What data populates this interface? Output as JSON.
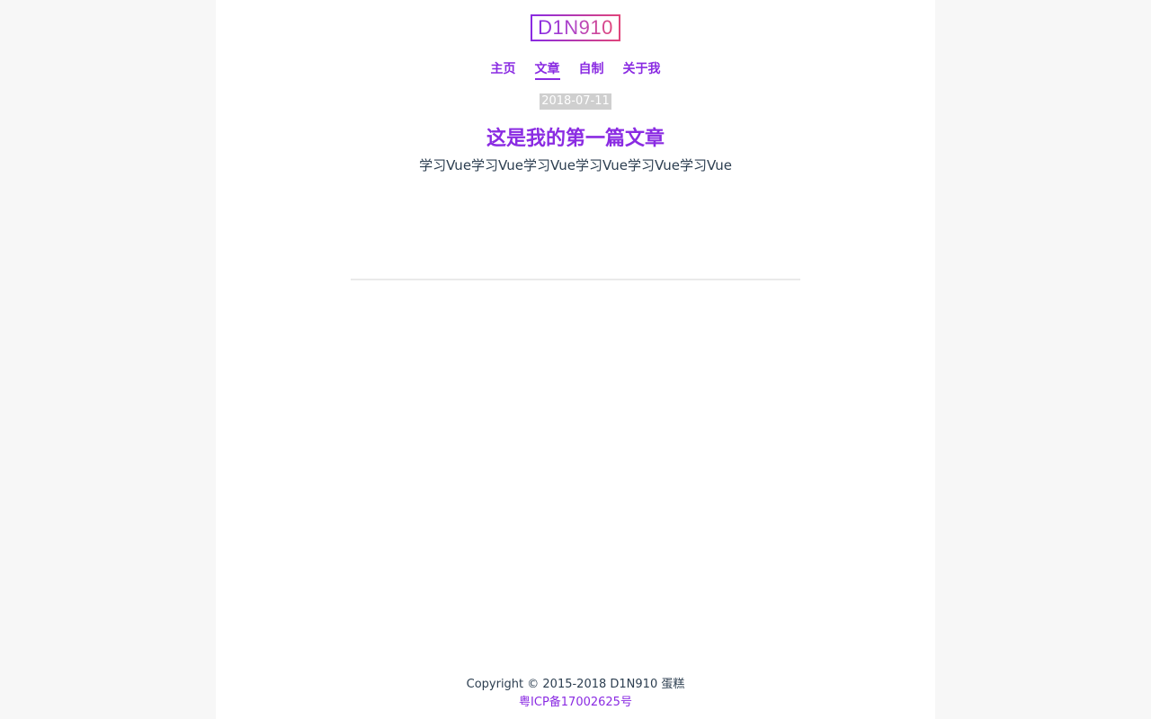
{
  "header": {
    "logo_text": "D1N910"
  },
  "nav": {
    "items": [
      {
        "label": "主页",
        "active": false
      },
      {
        "label": "文章",
        "active": true
      },
      {
        "label": "自制",
        "active": false
      },
      {
        "label": "关于我",
        "active": false
      }
    ]
  },
  "post": {
    "date": "2018-07-11",
    "title": "这是我的第一篇文章",
    "summary": "学习Vue学习Vue学习Vue学习Vue学习Vue学习Vue"
  },
  "footer": {
    "copyright": "Copyright © 2015-2018 D1N910 蛋糕",
    "icp": "粤ICP备17002625号"
  },
  "colors": {
    "accent": "#8a2be2",
    "accent_end": "#e0457b",
    "text": "#2c3e50",
    "date_bg": "#cfcfcf",
    "page_bg": "#f7f7f7"
  }
}
